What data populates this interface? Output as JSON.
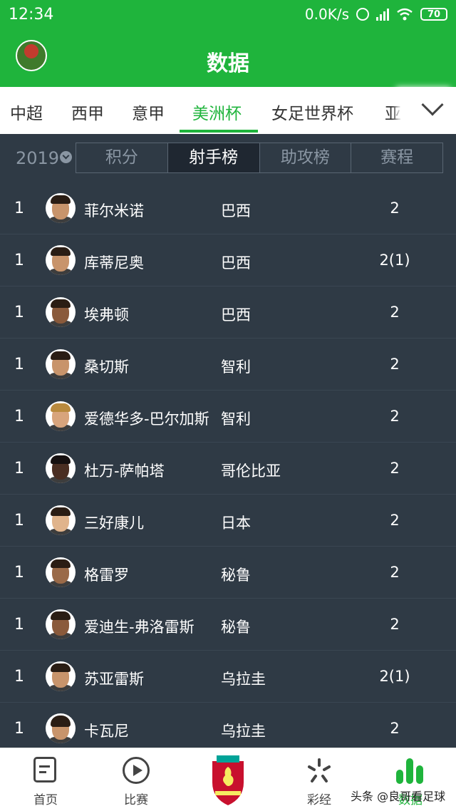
{
  "status_bar": {
    "time": "12:34",
    "net_speed": "0.0K/s",
    "battery": "70"
  },
  "app_bar": {
    "title": "数据"
  },
  "league_tabs": [
    {
      "label": "中超"
    },
    {
      "label": "西甲"
    },
    {
      "label": "意甲"
    },
    {
      "label": "美洲杯",
      "active": true
    },
    {
      "label": "女足世界杯"
    },
    {
      "label": "亚"
    }
  ],
  "season": "2019",
  "sub_tabs": [
    {
      "label": "积分"
    },
    {
      "label": "射手榜",
      "active": true
    },
    {
      "label": "助攻榜"
    },
    {
      "label": "赛程"
    }
  ],
  "players": [
    {
      "rank": "1",
      "name": "菲尔米诺",
      "team": "巴西",
      "goals": "2"
    },
    {
      "rank": "1",
      "name": "库蒂尼奥",
      "team": "巴西",
      "goals": "2(1)"
    },
    {
      "rank": "1",
      "name": "埃弗顿",
      "team": "巴西",
      "goals": "2"
    },
    {
      "rank": "1",
      "name": "桑切斯",
      "team": "智利",
      "goals": "2"
    },
    {
      "rank": "1",
      "name": "爱德华多-巴尔加斯",
      "team": "智利",
      "goals": "2"
    },
    {
      "rank": "1",
      "name": "杜万-萨帕塔",
      "team": "哥伦比亚",
      "goals": "2"
    },
    {
      "rank": "1",
      "name": "三好康儿",
      "team": "日本",
      "goals": "2"
    },
    {
      "rank": "1",
      "name": "格雷罗",
      "team": "秘鲁",
      "goals": "2"
    },
    {
      "rank": "1",
      "name": "爱迪生-弗洛雷斯",
      "team": "秘鲁",
      "goals": "2"
    },
    {
      "rank": "1",
      "name": "苏亚雷斯",
      "team": "乌拉圭",
      "goals": "2(1)"
    },
    {
      "rank": "1",
      "name": "卡瓦尼",
      "team": "乌拉圭",
      "goals": "2"
    }
  ],
  "bottom_nav": {
    "home": "首页",
    "matches": "比赛",
    "lottery": "彩经",
    "stats": "数据"
  },
  "watermark": "头条 @良哥看足球",
  "colors": {
    "accent": "#1fb43c",
    "background": "#2f3a45",
    "segment_active": "#1f2731"
  }
}
